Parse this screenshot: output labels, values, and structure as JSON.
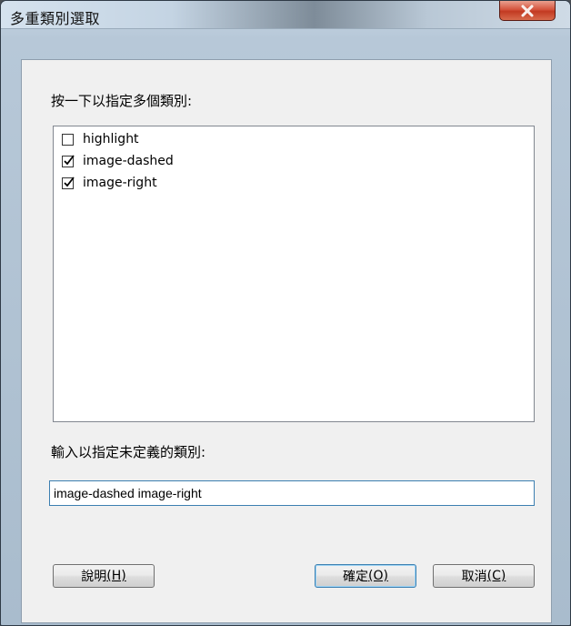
{
  "window": {
    "title": "多重類別選取",
    "close_label": "X"
  },
  "labels": {
    "select_prompt": "按一下以指定多個類別:",
    "input_prompt": "輸入以指定未定義的類別:"
  },
  "classes": [
    {
      "name": "highlight",
      "checked": false
    },
    {
      "name": "image-dashed",
      "checked": true
    },
    {
      "name": "image-right",
      "checked": true
    }
  ],
  "input": {
    "value": "image-dashed image-right"
  },
  "buttons": {
    "help": {
      "text": "說明",
      "mnemonic": "(H)"
    },
    "ok": {
      "text": "確定",
      "mnemonic": "(O)"
    },
    "cancel": {
      "text": "取消",
      "mnemonic": "(C)"
    }
  },
  "colors": {
    "close_button": "#c23a22",
    "focus_border": "#3c7fb1"
  }
}
